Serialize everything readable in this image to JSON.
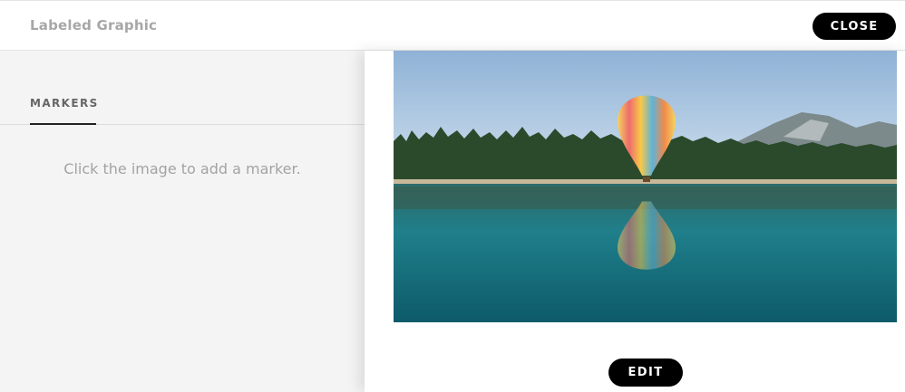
{
  "header": {
    "title": "Labeled Graphic",
    "close_label": "CLOSE"
  },
  "sidebar": {
    "tab_label": "MARKERS",
    "empty_hint": "Click the image to add a marker."
  },
  "canvas": {
    "image_subject": "hot-air-balloon-over-lake",
    "edit_label": "EDIT"
  },
  "colors": {
    "button_bg": "#000000",
    "sidebar_bg": "#f4f4f4",
    "title_color": "#a7a7a7"
  }
}
